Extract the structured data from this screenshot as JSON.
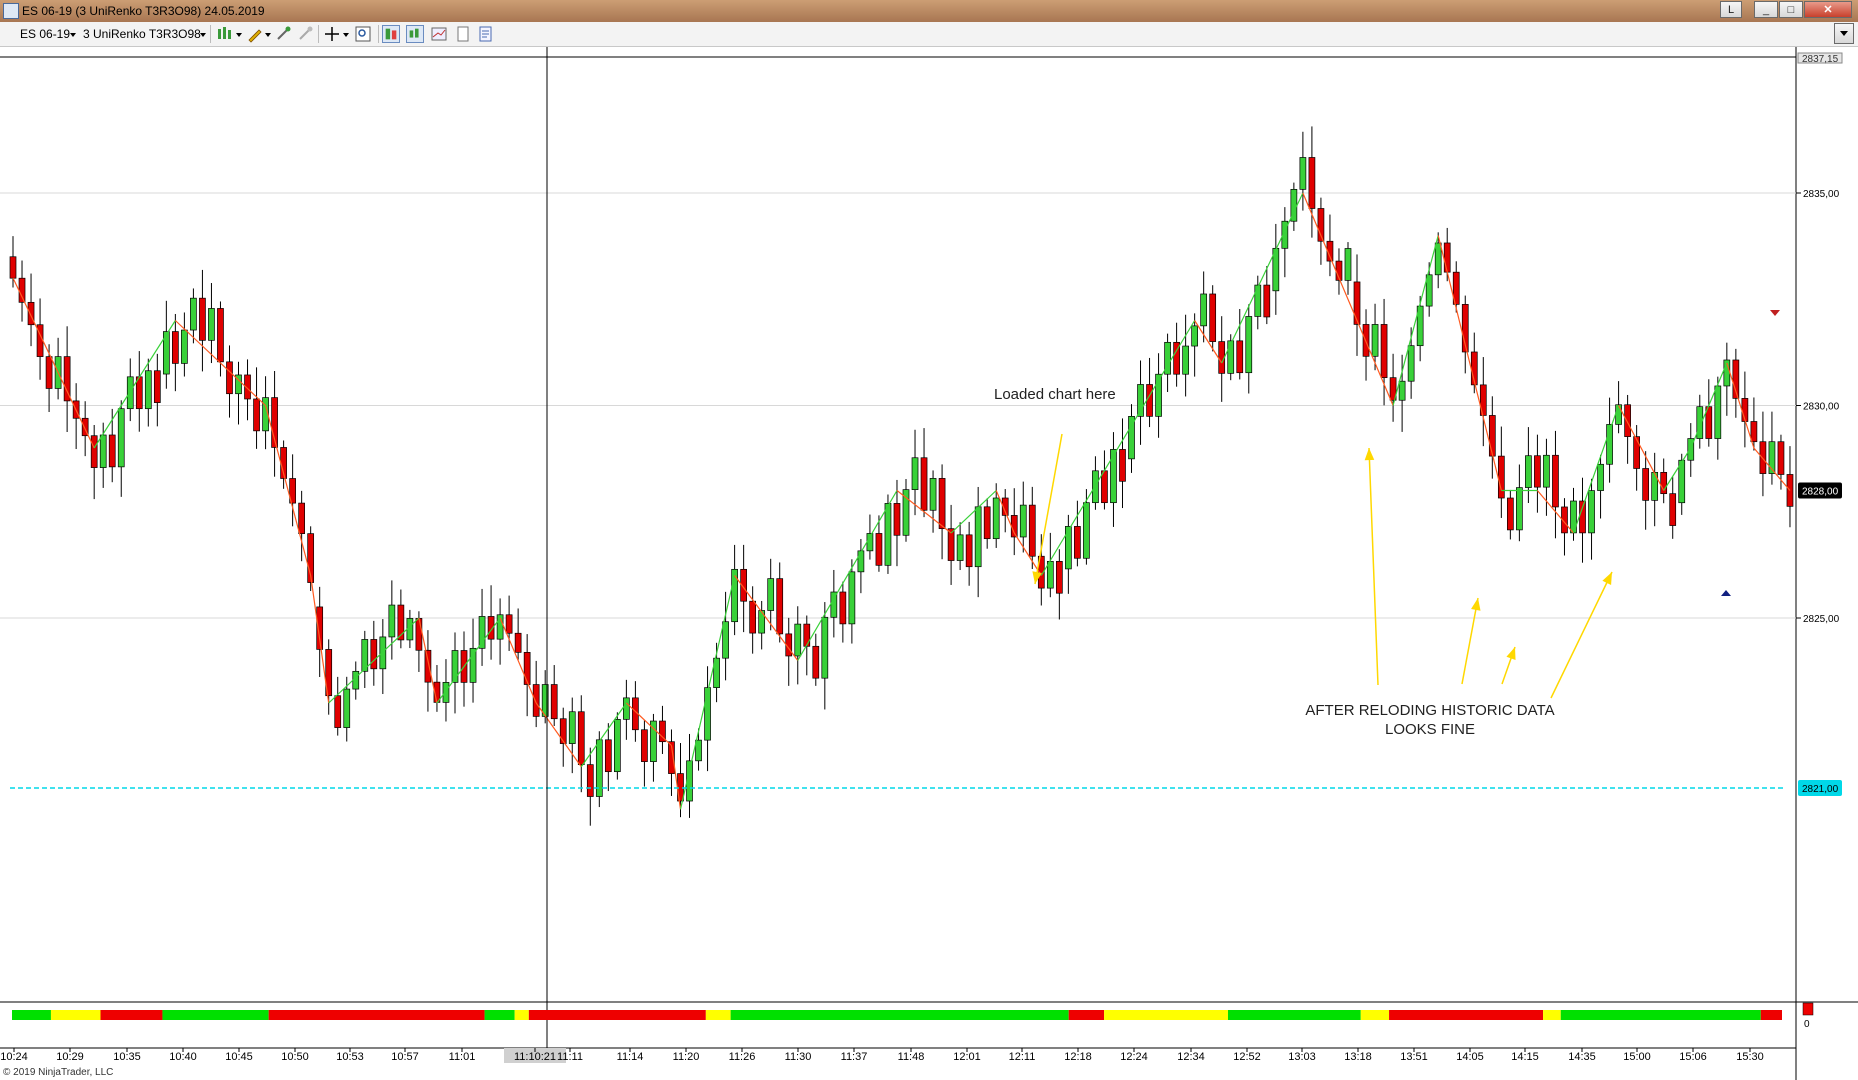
{
  "window": {
    "title": "ES 06-19 (3 UniRenko T3R3O98)  24.05.2019",
    "controls": [
      "L",
      "_",
      "□",
      "✕"
    ]
  },
  "toolbar": {
    "instrument": "ES 06-19",
    "period": "3 UniRenko T3R3O98"
  },
  "chart": {
    "copyright": "© 2019 NinjaTrader, LLC",
    "cursor_time_label": "11:10:21",
    "price_tags": [
      "2837,15",
      "2828,00",
      "2821,00"
    ],
    "volume_zero_label": "0",
    "annotations": [
      "Loaded chart here",
      "AFTER RELODING HISTORIC DATA",
      "LOOKS FINE"
    ],
    "colors": {
      "up_candle": "#39d139",
      "down_candle": "#e00000",
      "up_trend_line": "#39d139",
      "down_trend_line": "#ff5a20",
      "arrow": "#ffd800",
      "cyan_line": "#00d8e8",
      "last_price_tag": "#000000",
      "signal_bar_green": "#00e000",
      "signal_bar_yellow": "#ffff00",
      "signal_bar_red": "#ee0000"
    }
  },
  "chart_data": {
    "type": "candlestick",
    "title": "",
    "xlabel": "",
    "ylabel": "",
    "y_ticks": [
      2825,
      2830,
      2835
    ],
    "y_tick_labels": [
      "2825,00",
      "2830,00",
      "2835,00"
    ],
    "ylim": [
      2819.8,
      2838.2
    ],
    "x_tick_labels": [
      "10:24",
      "10:29",
      "10:35",
      "10:40",
      "10:45",
      "10:50",
      "10:53",
      "10:57",
      "11:01",
      "11:10:21",
      "11:11",
      "11:14",
      "11:20",
      "11:26",
      "11:30",
      "11:37",
      "11:48",
      "12:01",
      "12:11",
      "12:18",
      "12:24",
      "12:34",
      "12:52",
      "13:03",
      "13:18",
      "13:51",
      "14:05",
      "14:15",
      "14:35",
      "15:00",
      "15:06",
      "15:30"
    ],
    "grid": true,
    "last_price": 2828.0,
    "cyan_level": 2821.0,
    "path": [
      [
        0,
        2833.0
      ],
      [
        9,
        2829.0
      ],
      [
        18,
        2832.0
      ],
      [
        28,
        2830.0
      ],
      [
        33,
        2826.0
      ],
      [
        35,
        2823.0
      ],
      [
        45,
        2825.0
      ],
      [
        47,
        2823.0
      ],
      [
        54,
        2825.0
      ],
      [
        58,
        2823.0
      ],
      [
        63,
        2821.5
      ],
      [
        68,
        2823.0
      ],
      [
        73,
        2822.0
      ],
      [
        74,
        2820.5
      ],
      [
        80,
        2826.0
      ],
      [
        87,
        2824.0
      ],
      [
        98,
        2828.0
      ],
      [
        104,
        2827.0
      ],
      [
        109,
        2828.0
      ],
      [
        111,
        2827.0
      ],
      [
        114,
        2826.0
      ],
      [
        131,
        2832.0
      ],
      [
        134,
        2831.0
      ],
      [
        143,
        2835.0
      ],
      [
        153,
        2830.0
      ],
      [
        158,
        2834.0
      ],
      [
        165,
        2828.0
      ],
      [
        169,
        2828.0
      ],
      [
        173,
        2827.0
      ],
      [
        178,
        2830.0
      ],
      [
        183,
        2828.0
      ],
      [
        186,
        2829.0
      ],
      [
        190,
        2831.0
      ],
      [
        193,
        2829.0
      ],
      [
        197,
        2828.0
      ]
    ],
    "signal_bar_segments": [
      [
        "#00e000",
        0.0,
        0.022
      ],
      [
        "#ffff00",
        0.022,
        0.05
      ],
      [
        "#ee0000",
        0.05,
        0.085
      ],
      [
        "#00e000",
        0.085,
        0.145
      ],
      [
        "#ee0000",
        0.145,
        0.267
      ],
      [
        "#00e000",
        0.267,
        0.284
      ],
      [
        "#ffff00",
        0.284,
        0.292
      ],
      [
        "#ee0000",
        0.292,
        0.392
      ],
      [
        "#ffff00",
        0.392,
        0.406
      ],
      [
        "#00e000",
        0.406,
        0.597
      ],
      [
        "#ee0000",
        0.597,
        0.617
      ],
      [
        "#ffff00",
        0.617,
        0.687
      ],
      [
        "#00e000",
        0.687,
        0.762
      ],
      [
        "#ffff00",
        0.762,
        0.778
      ],
      [
        "#ee0000",
        0.778,
        0.865
      ],
      [
        "#ffff00",
        0.865,
        0.875
      ],
      [
        "#00e000",
        0.875,
        0.988
      ],
      [
        "#ee0000",
        0.988,
        1.0
      ]
    ],
    "series": [
      {
        "values": "generated candles following path (renko bricks)"
      }
    ]
  }
}
